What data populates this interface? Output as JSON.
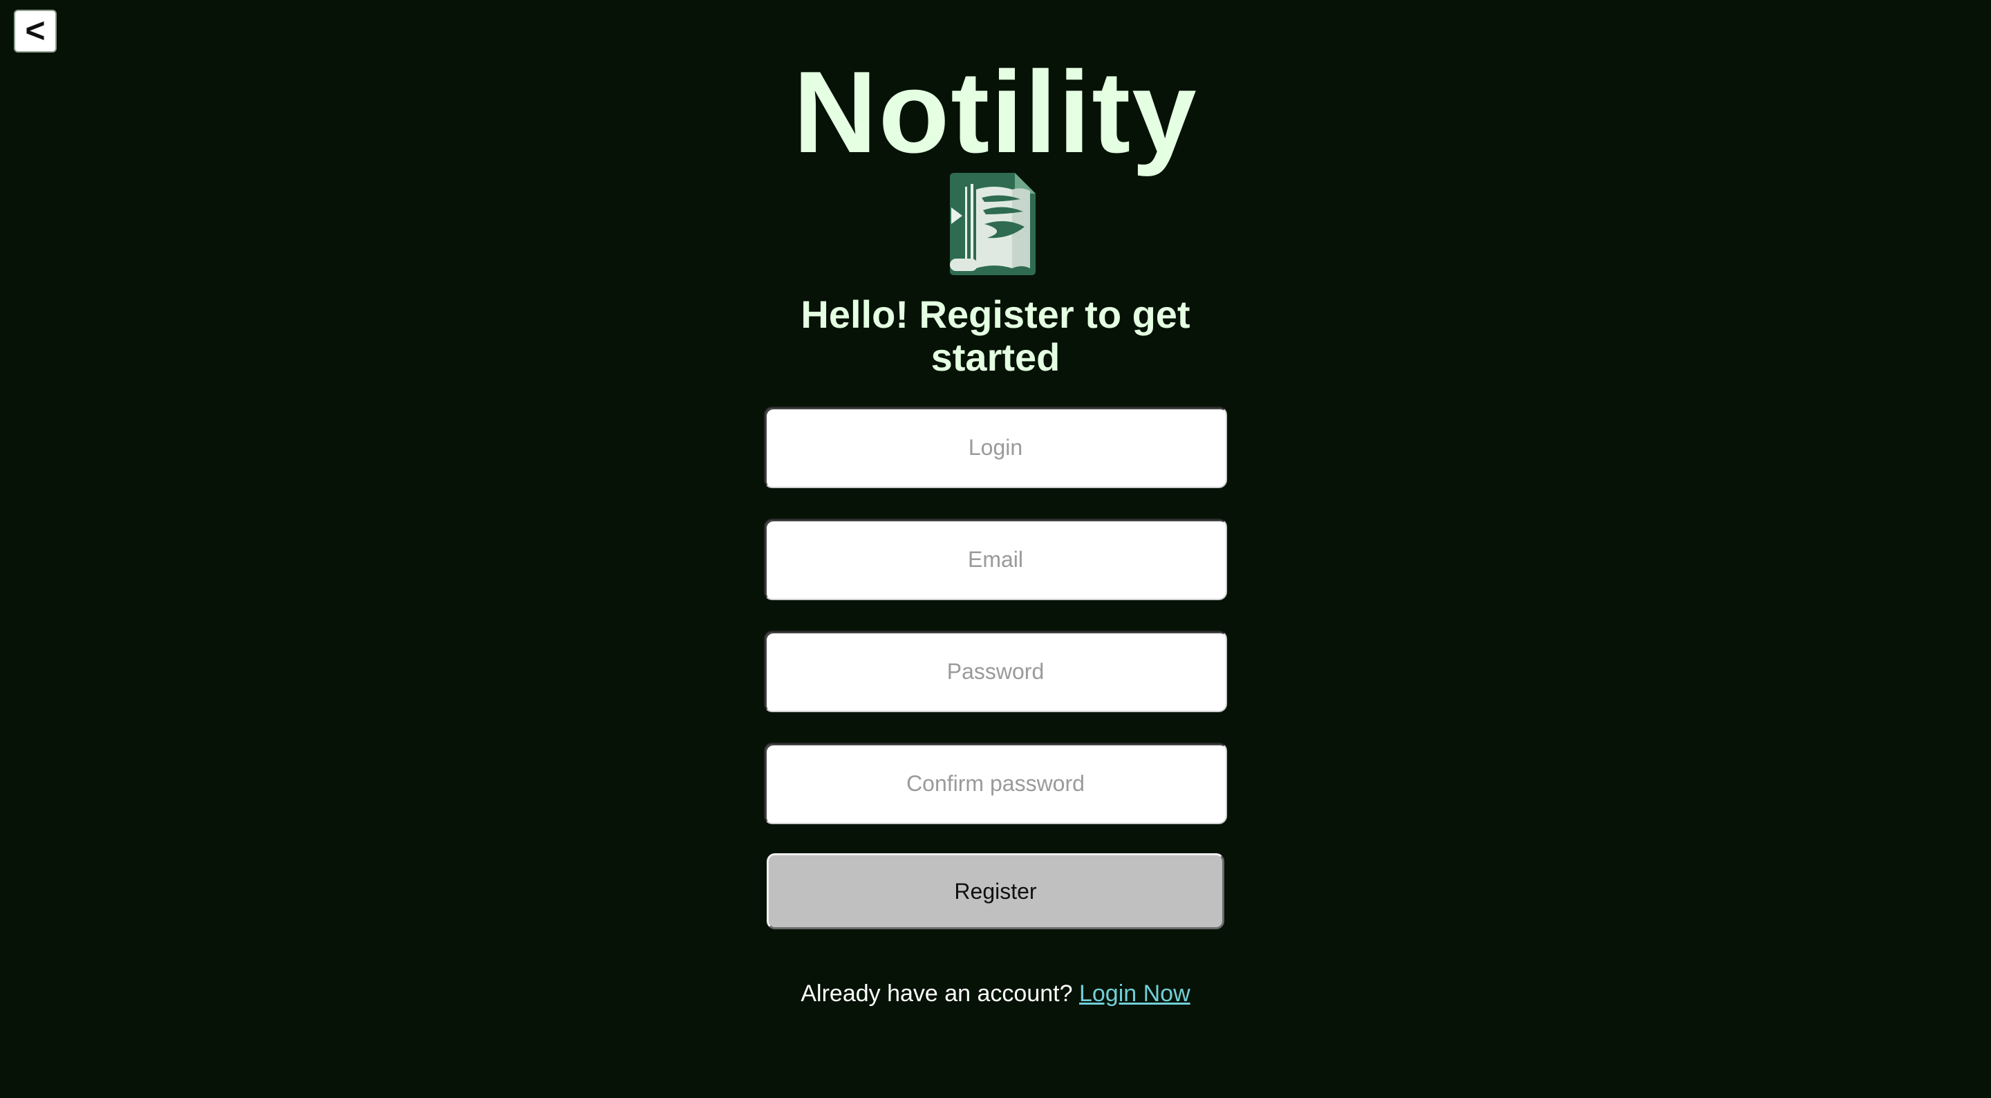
{
  "nav": {
    "back_label": "<"
  },
  "brand": {
    "title": "Notility",
    "logo_icon": "book-document-icon"
  },
  "headline": "Hello! Register to get started",
  "form": {
    "login_placeholder": "Login",
    "email_placeholder": "Email",
    "password_placeholder": "Password",
    "confirm_placeholder": "Confirm password",
    "register_label": "Register"
  },
  "footer": {
    "prompt": "Already have an account?",
    "link_label": "Login Now"
  },
  "colors": {
    "background": "#061206",
    "title": "#e4ffe2",
    "link": "#72cfd8",
    "logo_green": "#2f6b50"
  }
}
